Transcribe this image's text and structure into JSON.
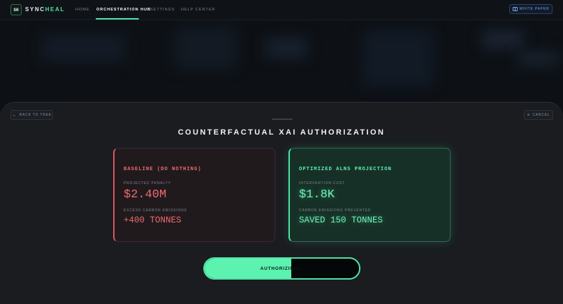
{
  "app": {
    "logo_mark": "SH",
    "brand_part1": "SYNC",
    "brand_part2": "HEAL"
  },
  "nav": {
    "items": [
      {
        "label": "HOME",
        "active": false
      },
      {
        "label": "ORCHESTRATION HUB",
        "active": true
      },
      {
        "label": "SETTINGS",
        "active": false
      },
      {
        "label": "HELP CENTER",
        "active": false
      }
    ],
    "white_paper_label": "WHITE PAPER"
  },
  "modal": {
    "back_label": "BACK TO TREE",
    "cancel_label": "CANCEL",
    "title": "COUNTERFACTUAL XAI AUTHORIZATION"
  },
  "baseline": {
    "title": "BASELINE (DO NOTHING)",
    "metric1_label": "PROJECTED PENALTY",
    "metric1_value": "$2.40M",
    "metric2_label": "EXCESS CARBON EMISSIONS",
    "metric2_value": "+400 TONNES"
  },
  "optimized": {
    "title": "OPTIMIZED ALNS PROJECTION",
    "metric1_label": "INTERVENTION COST",
    "metric1_value": "$1.8K",
    "metric2_label": "CARBON EMISSIONS PREVENTED",
    "metric2_value": "SAVED 150 TONNES"
  },
  "authorize": {
    "label": "AUTHORIZING...",
    "progress": 0.56
  },
  "colors": {
    "accent": "#4fe3a6",
    "danger": "#ef6a6f",
    "link": "#7ea6e0"
  },
  "icons": {
    "back": "arrow-left-icon",
    "cancel": "close-icon",
    "white_paper": "book-icon"
  }
}
